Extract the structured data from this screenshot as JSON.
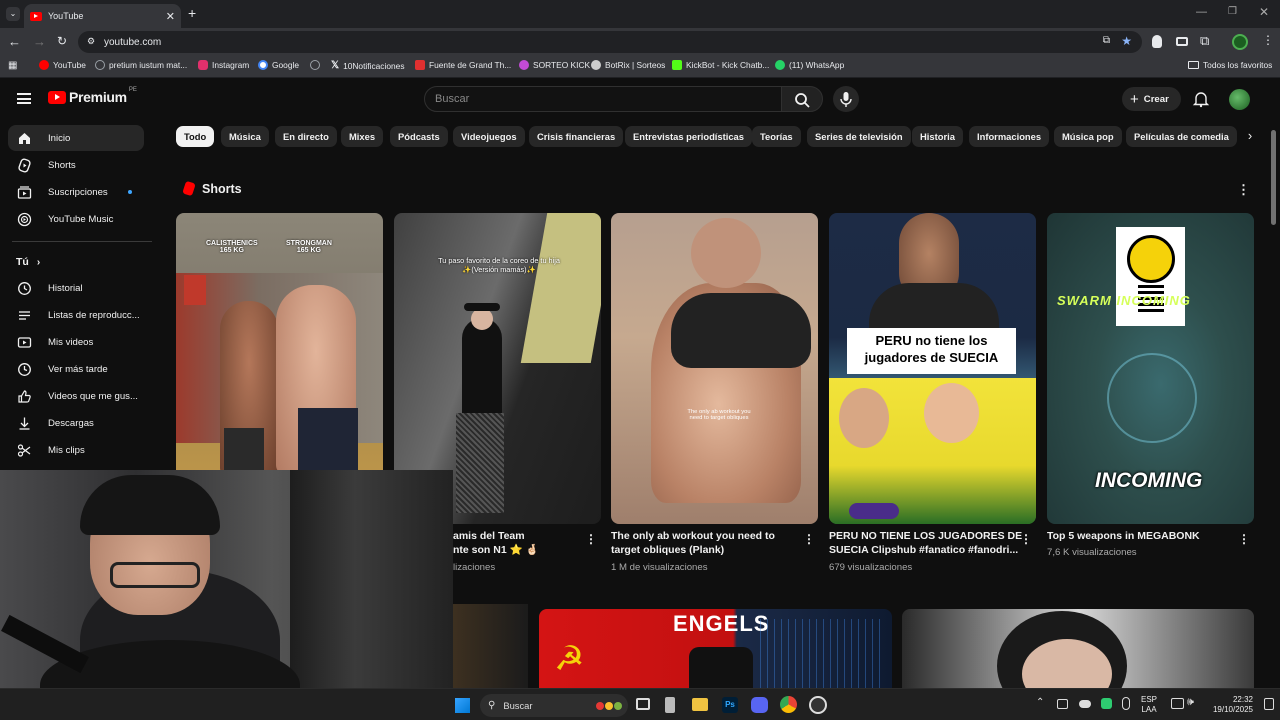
{
  "browser": {
    "tab_title": "YouTube",
    "url": "youtube.com",
    "bookmarks": [
      {
        "label": "YouTube",
        "icon": "youtube-icon",
        "color": "#ff0000"
      },
      {
        "label": "pretium iustum mat...",
        "icon": "globe-icon",
        "color": "#9aa0a6"
      },
      {
        "label": "Instagram",
        "icon": "instagram-icon",
        "color": "#e1306c"
      },
      {
        "label": "Google",
        "icon": "google-icon",
        "color": "#4285f4"
      },
      {
        "label": "",
        "icon": "globe-icon",
        "color": "#9aa0a6"
      },
      {
        "label": "10Notificaciones",
        "icon": "x-icon",
        "color": "#ffffff"
      },
      {
        "label": "Fuente de Grand Th...",
        "icon": "font-icon",
        "color": "#e03030"
      },
      {
        "label": "SORTEO KICK",
        "icon": "sorteo-icon",
        "color": "#c44bd6"
      },
      {
        "label": "BotRix | Sorteos",
        "icon": "botrix-icon",
        "color": "#cccccc"
      },
      {
        "label": "KickBot - Kick Chatb...",
        "icon": "kickbot-icon",
        "color": "#53fc18"
      },
      {
        "label": "(11) WhatsApp",
        "icon": "whatsapp-icon",
        "color": "#25d366"
      }
    ],
    "all_favorites": "Todos los favoritos"
  },
  "youtube": {
    "logo_text": "Premium",
    "region": "PE",
    "search_placeholder": "Buscar",
    "create_label": "Crear",
    "accent": "#ff0000"
  },
  "sidebar": {
    "items": [
      {
        "label": "Inicio",
        "icon": "home-icon"
      },
      {
        "label": "Shorts",
        "icon": "shorts-icon"
      },
      {
        "label": "Suscripciones",
        "icon": "subscriptions-icon"
      },
      {
        "label": "YouTube Music",
        "icon": "music-icon"
      }
    ],
    "you_label": "Tú",
    "you_items": [
      {
        "label": "Historial",
        "icon": "history-icon"
      },
      {
        "label": "Listas de reproducc...",
        "icon": "playlist-icon"
      },
      {
        "label": "Mis videos",
        "icon": "videos-icon"
      },
      {
        "label": "Ver más tarde",
        "icon": "clock-icon"
      },
      {
        "label": "Videos que me gus...",
        "icon": "like-icon"
      },
      {
        "label": "Descargas",
        "icon": "download-icon"
      },
      {
        "label": "Mis clips",
        "icon": "scissors-icon"
      }
    ]
  },
  "chips": [
    "Todo",
    "Música",
    "En directo",
    "Mixes",
    "Pódcasts",
    "Videojuegos",
    "Crisis financieras",
    "Entrevistas periodísticas",
    "Teorías",
    "Series de televisión",
    "Historia",
    "Informaciones",
    "Música pop",
    "Películas de comedia"
  ],
  "shorts": {
    "section_title": "Shorts",
    "items": [
      {
        "title": "",
        "views": "",
        "overlay": [
          "CALISTHENICS\n165 KG",
          "STRONGMAN\n165 KG"
        ]
      },
      {
        "title": "amis del Team\nnte son N1 ⭐ 🤞🏻",
        "views": "lizaciones",
        "overlay": [
          "Tu paso favorito de la coreo de tu hija\n✨(Versión mamás)✨"
        ]
      },
      {
        "title": "The only ab workout you need to\ntarget obliques (Plank)",
        "views": "1 M de visualizaciones",
        "overlay": [
          "The only ab workout you\nneed to target obliques"
        ]
      },
      {
        "title": "PERU NO TIENE LOS JUGADORES DE\nSUECIA Clipshub #fanatico #fanodri...",
        "views": "679 visualizaciones",
        "overlay": [
          "PERU no tiene los\njugadores de SUECIA"
        ]
      },
      {
        "title": "Top 5 weapons in MEGABONK",
        "views": "7,6 K visualizaciones",
        "overlay": [
          "SWARM INCOMING",
          "INCOMING"
        ]
      }
    ]
  },
  "second_row": {
    "overlay": [
      "ENGELS"
    ]
  },
  "taskbar": {
    "search_label": "Buscar",
    "language": "ESP",
    "language_sub": "LAA",
    "time": "22:32",
    "date": "19/10/2025"
  }
}
